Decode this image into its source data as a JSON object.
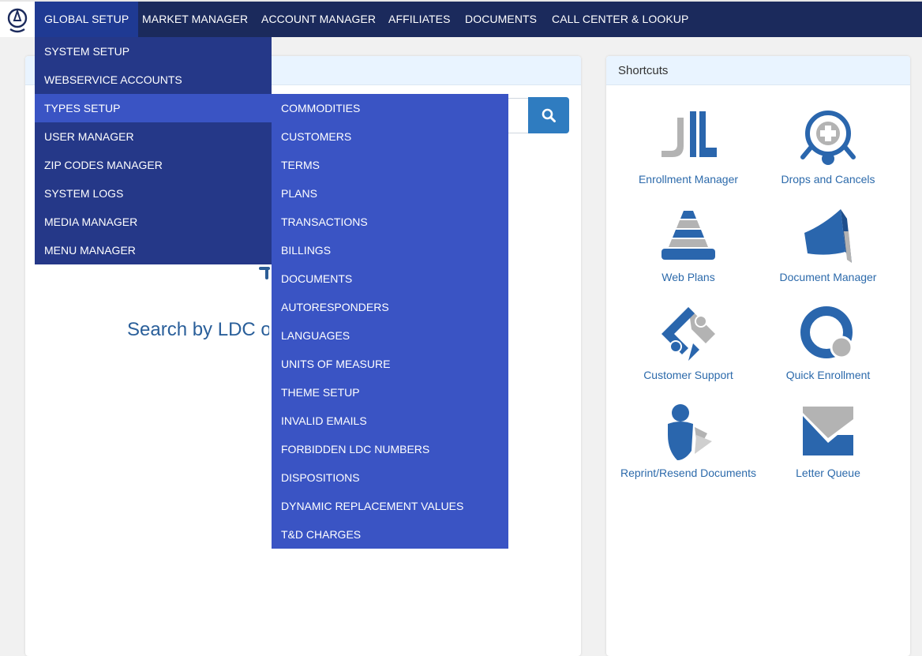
{
  "nav": {
    "items": [
      "GLOBAL SETUP",
      "MARKET MANAGER",
      "ACCOUNT MANAGER",
      "AFFILIATES",
      "DOCUMENTS",
      "CALL CENTER & LOOKUP"
    ]
  },
  "global_setup_menu": {
    "items": [
      "SYSTEM SETUP",
      "WEBSERVICE ACCOUNTS",
      "TYPES SETUP",
      "USER MANAGER",
      "ZIP CODES MANAGER",
      "SYSTEM LOGS",
      "MEDIA MANAGER",
      "MENU MANAGER"
    ]
  },
  "types_setup_menu": {
    "items": [
      "COMMODITIES",
      "CUSTOMERS",
      "TERMS",
      "PLANS",
      "TRANSACTIONS",
      "BILLINGS",
      "DOCUMENTS",
      "AUTORESPONDERS",
      "LANGUAGES",
      "UNITS OF MEASURE",
      "THEME SETUP",
      "INVALID EMAILS",
      "FORBIDDEN LDC NUMBERS",
      "DISPOSITIONS",
      "DYNAMIC REPLACEMENT VALUES",
      "T&D CHARGES"
    ]
  },
  "main": {
    "search_heading": "Search by LDC o"
  },
  "shortcuts": {
    "title": "Shortcuts",
    "items": [
      "Enrollment Manager",
      "Drops and Cancels",
      "Web Plans",
      "Document Manager",
      "Customer Support",
      "Quick Enrollment",
      "Reprint/Resend Documents",
      "Letter Queue"
    ]
  },
  "colors": {
    "navbar": "#1b2a5c",
    "menu_primary": "#253888",
    "menu_secondary": "#3a54c4",
    "accent_blue": "#2f7cc0",
    "icon_gray": "#b3b3b3"
  }
}
